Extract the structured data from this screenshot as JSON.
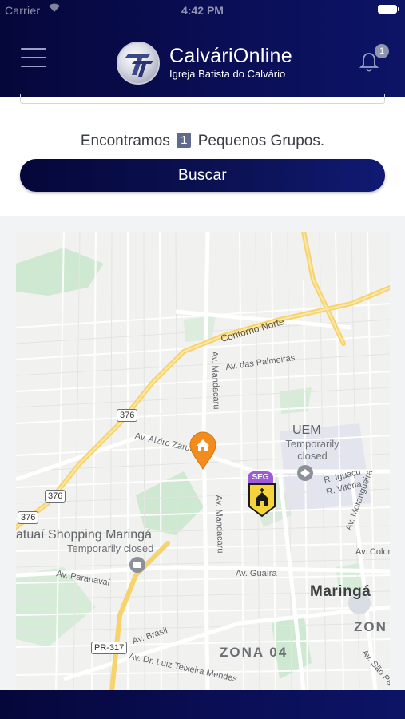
{
  "status_bar": {
    "carrier": "Carrier",
    "time": "4:42 PM"
  },
  "header": {
    "app_title": "CalváriOnline",
    "app_subtitle": "Igreja Batista do Calvário",
    "notification_count": "1"
  },
  "search": {
    "result_prefix": "Encontramos",
    "result_count": "1",
    "result_suffix": "Pequenos Grupos.",
    "button_label": "Buscar"
  },
  "map": {
    "roads": {
      "contorno_norte": "Contorno Norte",
      "palmeiras": "Av. das Palmeiras",
      "mandacaru_1": "Av. Mandacaru",
      "mandacaru_2": "Av. Mandacaru",
      "alziro_zarur": "Av. Alziro Zarur",
      "iguacu": "R. Iguaçu",
      "vitoria": "R. Vitória",
      "morangueira": "Av. Morangueira",
      "colombo": "Av. Colom",
      "guaira": "Av. Guaíra",
      "paranavai": "Av. Paranavaí",
      "brasil": "Av. Brasil",
      "luiz_teixeira": "Av. Dr. Luiz Teixeira Mendes",
      "sao_paulo": "Av. São Pa"
    },
    "shields": [
      "376",
      "376",
      "376",
      "PR-317"
    ],
    "pois": {
      "uem_name": "UEM",
      "uem_status": "Temporarily closed",
      "shopping_name": "atuaí Shopping Maringá",
      "shopping_status": "Temporarily closed"
    },
    "city": "Maringá",
    "zones": [
      "ZONA 04",
      "ZON"
    ],
    "church_marker_tag": "SEG"
  },
  "colors": {
    "header_dark": "#05073a",
    "header_light": "#0d1466",
    "home_marker": "#f28c1c",
    "church_marker": "#f5d33b",
    "seg_tag": "#9b5ad8"
  }
}
